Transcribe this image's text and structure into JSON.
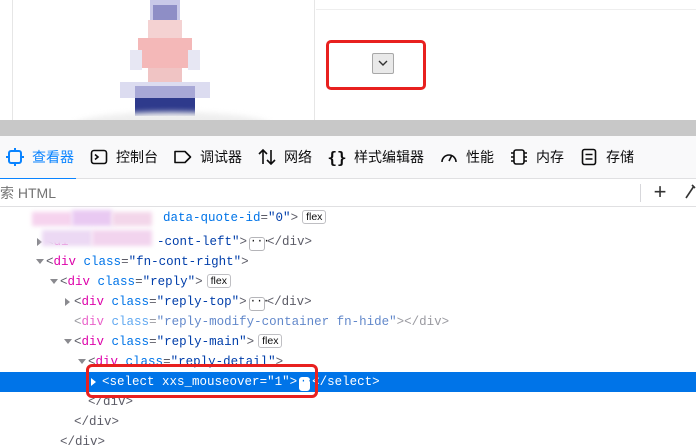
{
  "devtools": {
    "tabs": [
      {
        "label": "查看器",
        "icon": "inspector-icon",
        "active": true
      },
      {
        "label": "控制台",
        "icon": "console-icon"
      },
      {
        "label": "调试器",
        "icon": "debugger-icon"
      },
      {
        "label": "网络",
        "icon": "network-icon"
      },
      {
        "label": "样式编辑器",
        "icon": "style-editor-icon"
      },
      {
        "label": "性能",
        "icon": "performance-icon"
      },
      {
        "label": "内存",
        "icon": "memory-icon"
      },
      {
        "label": "存储",
        "icon": "storage-icon"
      }
    ],
    "accent_color": "#0a84ff",
    "selection_color": "#0074e8"
  },
  "search": {
    "placeholder": "索 HTML",
    "value": ""
  },
  "tree": {
    "row0": {
      "attr": "data-quote-id",
      "value": "\"0\"",
      "badge": "flex"
    },
    "row1": {
      "partial_value": "-cont-left\"",
      "close": "</div>"
    },
    "row2": {
      "tag": "div",
      "attr": "class",
      "value": "\"fn-cont-right\""
    },
    "row3": {
      "tag": "div",
      "attr": "class",
      "value": "\"reply\"",
      "badge": "flex"
    },
    "row4": {
      "tag": "div",
      "attr": "class",
      "value": "\"reply-top\"",
      "close": "</div>"
    },
    "row5": {
      "tag": "div",
      "attr": "class",
      "value": "\"reply-modify-container fn-hide\"",
      "close": "</div>"
    },
    "row6": {
      "tag": "div",
      "attr": "class",
      "value": "\"reply-main\"",
      "badge": "flex"
    },
    "row7": {
      "tag": "div",
      "attr": "class",
      "value": "\"reply-detail\""
    },
    "row8": {
      "tag": "select",
      "attr": "xxs_mouseover",
      "value": "\"1\"",
      "close": "</select>"
    },
    "row9": {
      "close": "</div>"
    },
    "row10": {
      "close": "</div>"
    },
    "row11": {
      "close": "</div>"
    }
  },
  "colors": {
    "highlight_box": "#e8201f",
    "tag": "#dd00a9",
    "attr_name": "#0074e8",
    "attr_value": "#003eaa"
  }
}
